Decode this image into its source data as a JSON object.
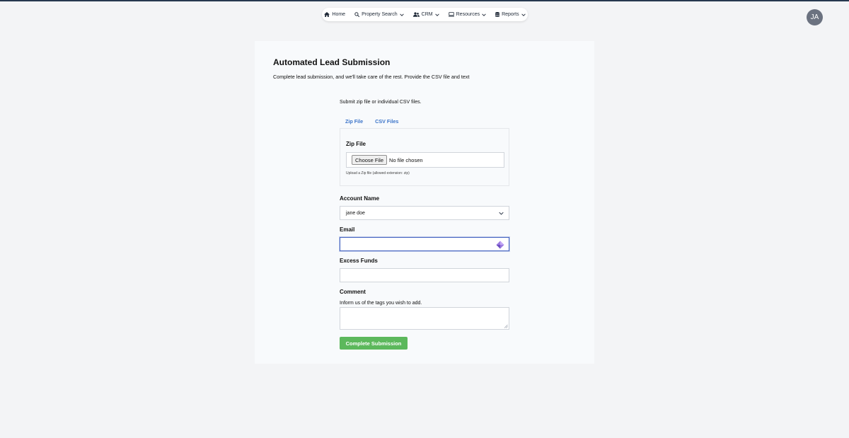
{
  "nav": {
    "items": [
      {
        "label": "Home",
        "icon": "home-icon"
      },
      {
        "label": "Property Search",
        "icon": "search-icon",
        "dropdown": true
      },
      {
        "label": "CRM",
        "icon": "users-icon",
        "dropdown": true
      },
      {
        "label": "Resources",
        "icon": "monitor-icon",
        "dropdown": true
      },
      {
        "label": "Reports",
        "icon": "database-icon",
        "dropdown": true
      }
    ]
  },
  "user": {
    "initials": "JA"
  },
  "page": {
    "title": "Automated Lead Submission",
    "subtitle": "Complete lead submission, and we'll take care of the rest. Provide the CSV file and text"
  },
  "form": {
    "hint": "Submit zip file or individual CSV files.",
    "tabs": [
      {
        "label": "Zip File"
      },
      {
        "label": "CSV Files"
      }
    ],
    "zip": {
      "label": "Zip File",
      "button_label": "Choose File",
      "status": "No file chosen",
      "help": "Upload a Zip file (allowed extension: zip)"
    },
    "account": {
      "label": "Account Name",
      "value": "jane doe"
    },
    "email": {
      "label": "Email",
      "value": ""
    },
    "funds": {
      "label": "Excess Funds",
      "value": ""
    },
    "comment": {
      "label": "Comment",
      "help": "Inform us of the tags you wish to add.",
      "value": ""
    },
    "submit_label": "Complete Submission"
  },
  "colors": {
    "accent_link": "#3b74c9",
    "submit": "#5cb85c",
    "focus_border": "#3f5fbf",
    "top_bar": "#26384f"
  }
}
